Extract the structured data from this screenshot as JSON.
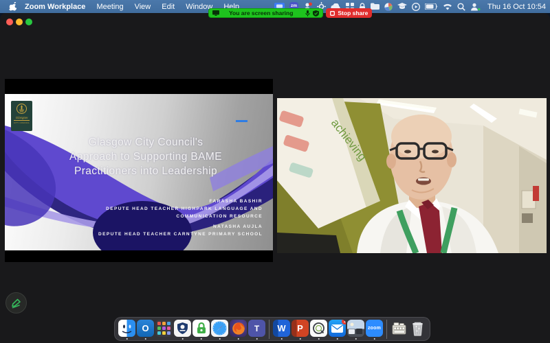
{
  "menubar": {
    "app_name": "Zoom Workplace",
    "menus": [
      "Meeting",
      "View",
      "Edit",
      "Window",
      "Help"
    ],
    "zm_badge": "zm",
    "clock": "Thu 16 Oct 10:54"
  },
  "share_banner": {
    "message": "You are screen sharing",
    "stop_label": "Stop share"
  },
  "slide": {
    "title_lines": [
      "Glasgow City Council's",
      "Approach to Supporting BAME",
      "Practitioners into Leadership"
    ],
    "presenters": [
      {
        "name": "FARASHA BASHIR",
        "role": "DEPUTE HEAD TEACHER HIGHPARK LANGUAGE AND COMMUNICATION RESOURCE"
      },
      {
        "name": "NATASHA AUJLA",
        "role": "DEPUTE HEAD TEACHER CARNTYNE PRIMARY SCHOOL"
      }
    ],
    "logo": {
      "line1": "Glasgow",
      "line2": "CITY COUNCIL"
    },
    "colors": {
      "ribbon_purple": "#5f49cf",
      "ribbon_dark": "#1b1464",
      "accent_blue": "#2e7de5"
    }
  },
  "video": {
    "poster_text": "achieving",
    "colors": {
      "wall_olive": "#8f8f33",
      "tie_red": "#8c2332",
      "lanyard_green": "#3f9f5f"
    }
  },
  "dock": {
    "items": [
      "finder",
      "outlook",
      "launchpad",
      "council-crest",
      "lock",
      "safari",
      "firefox",
      "teams",
      "word",
      "powerpoint",
      "quicktime",
      "mail",
      "preview",
      "zoom",
      "file-cabinet",
      "trash"
    ],
    "glyphs": {
      "outlook": "O",
      "teams": "T",
      "word": "W",
      "powerpoint": "P",
      "zoom": "zoom"
    },
    "mail_badge": "1"
  },
  "colors": {
    "menubar_blue": "#44709f",
    "banner_green": "#1ec31e",
    "stop_red": "#e12d2d",
    "annotate_green": "#35b95c"
  }
}
